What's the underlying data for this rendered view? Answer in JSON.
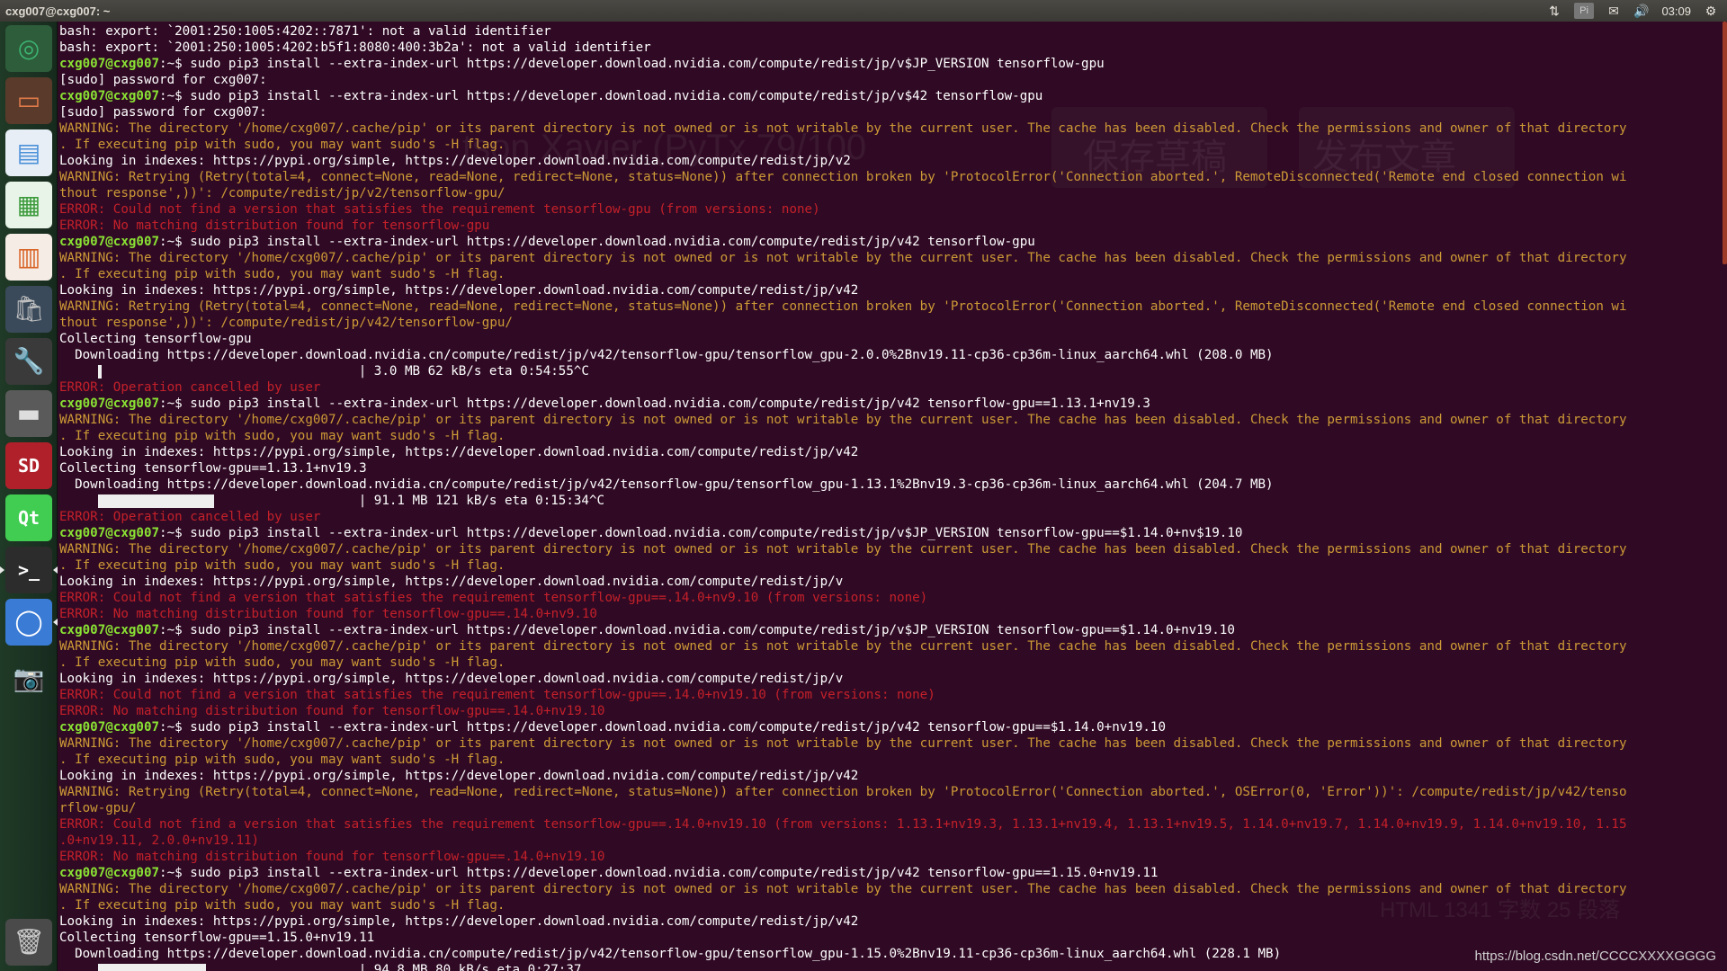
{
  "topbar": {
    "title": "cxg007@cxg007: ~",
    "indicators": {
      "network": "⇅",
      "keyboard": "Pi",
      "mail": "✉",
      "volume": "🔊",
      "clock": "03:09",
      "settings": "⚙"
    }
  },
  "launcher": {
    "items": [
      {
        "name": "chromium-icon",
        "glyph": "◎",
        "color": "#3cb371",
        "bg": "#2d5d3a"
      },
      {
        "name": "files-icon",
        "glyph": "▭",
        "color": "#e07a4a",
        "bg": "#5a3a2a"
      },
      {
        "name": "writer-icon",
        "glyph": "▤",
        "color": "#4a90d9",
        "bg": "#e8eef6"
      },
      {
        "name": "calc-icon",
        "glyph": "▦",
        "color": "#3a9a3a",
        "bg": "#e8f4e8"
      },
      {
        "name": "impress-icon",
        "glyph": "▥",
        "color": "#d9662a",
        "bg": "#f6ece6"
      },
      {
        "name": "software-center-icon",
        "glyph": "🛍",
        "color": "#c0c0c0",
        "bg": "#3a4a5a"
      },
      {
        "name": "system-settings-icon",
        "glyph": "🔧",
        "color": "#c0c0c0",
        "bg": "#3a3a3a"
      },
      {
        "name": "drive-icon",
        "glyph": "▬",
        "color": "#dddddd",
        "bg": "#5a5a5a"
      },
      {
        "name": "sd-card-icon",
        "glyph": "SD",
        "color": "#ffffff",
        "bg": "#b0202a"
      },
      {
        "name": "qt-creator-icon",
        "glyph": "Qt",
        "color": "#ffffff",
        "bg": "#41cd52"
      },
      {
        "name": "terminal-icon",
        "glyph": ">_",
        "color": "#ffffff",
        "bg": "#2c2c2c"
      },
      {
        "name": "browser-icon",
        "glyph": "◯",
        "color": "#ffffff",
        "bg": "#3a7bd5"
      },
      {
        "name": "camera-icon",
        "glyph": "📷",
        "color": "#aaaaaa",
        "bg": "transparent"
      },
      {
        "name": "trash-icon",
        "glyph": "🗑",
        "color": "#cccccc",
        "bg": "#4a4a4a"
      }
    ]
  },
  "terminal": {
    "prompt_user": "cxg007@cxg007",
    "prompt_sep": ":~$ ",
    "background_ghost": [
      "tson Xavier (PyTx 79/100",
      "保存草稿",
      "发布文章"
    ],
    "footer_ghost": "HTML  1341 字数  25 段落",
    "lines": [
      {
        "t": "bash: export: `2001:250:1005:4202::7871': not a valid identifier"
      },
      {
        "t": "bash: export: `2001:250:1005:4202:b5f1:8080:400:3b2a': not a valid identifier"
      },
      {
        "type": "cmd",
        "t": "sudo pip3 install --extra-index-url https://developer.download.nvidia.com/compute/redist/jp/v$JP_VERSION tensorflow-gpu"
      },
      {
        "t": "[sudo] password for cxg007:"
      },
      {
        "type": "cmd",
        "t": "sudo pip3 install --extra-index-url https://developer.download.nvidia.com/compute/redist/jp/v$42 tensorflow-gpu"
      },
      {
        "t": "[sudo] password for cxg007:"
      },
      {
        "c": "warn",
        "t": "WARNING: The directory '/home/cxg007/.cache/pip' or its parent directory is not owned or is not writable by the current user. The cache has been disabled. Check the permissions and owner of that directory"
      },
      {
        "c": "warn",
        "t": ". If executing pip with sudo, you may want sudo's -H flag."
      },
      {
        "t": "Looking in indexes: https://pypi.org/simple, https://developer.download.nvidia.com/compute/redist/jp/v2"
      },
      {
        "c": "warn",
        "t": "WARNING: Retrying (Retry(total=4, connect=None, read=None, redirect=None, status=None)) after connection broken by 'ProtocolError('Connection aborted.', RemoteDisconnected('Remote end closed connection wi"
      },
      {
        "c": "warn",
        "t": "thout response',))': /compute/redist/jp/v2/tensorflow-gpu/"
      },
      {
        "c": "err",
        "t": "ERROR: Could not find a version that satisfies the requirement tensorflow-gpu (from versions: none)"
      },
      {
        "c": "err",
        "t": "ERROR: No matching distribution found for tensorflow-gpu"
      },
      {
        "type": "cmd",
        "t": "sudo pip3 install --extra-index-url https://developer.download.nvidia.com/compute/redist/jp/v42 tensorflow-gpu"
      },
      {
        "c": "warn",
        "t": "WARNING: The directory '/home/cxg007/.cache/pip' or its parent directory is not owned or is not writable by the current user. The cache has been disabled. Check the permissions and owner of that directory"
      },
      {
        "c": "warn",
        "t": ". If executing pip with sudo, you may want sudo's -H flag."
      },
      {
        "t": "Looking in indexes: https://pypi.org/simple, https://developer.download.nvidia.com/compute/redist/jp/v42"
      },
      {
        "c": "warn",
        "t": "WARNING: Retrying (Retry(total=4, connect=None, read=None, redirect=None, status=None)) after connection broken by 'ProtocolError('Connection aborted.', RemoteDisconnected('Remote end closed connection wi"
      },
      {
        "c": "warn",
        "t": "thout response',))': /compute/redist/jp/v42/tensorflow-gpu/"
      },
      {
        "t": "Collecting tensorflow-gpu"
      },
      {
        "t": "  Downloading https://developer.download.nvidia.cn/compute/redist/jp/v42/tensorflow-gpu/tensorflow_gpu-2.0.0%2Bnv19.11-cp36-cp36m-linux_aarch64.whl (208.0 MB)"
      },
      {
        "type": "prog",
        "fill": 0.014,
        "t": "| 3.0 MB 62 kB/s eta 0:54:55^C"
      },
      {
        "c": "err",
        "t": "ERROR: Operation cancelled by user"
      },
      {
        "type": "cmd",
        "t": "sudo pip3 install --extra-index-url https://developer.download.nvidia.com/compute/redist/jp/v42 tensorflow-gpu==1.13.1+nv19.3"
      },
      {
        "c": "warn",
        "t": "WARNING: The directory '/home/cxg007/.cache/pip' or its parent directory is not owned or is not writable by the current user. The cache has been disabled. Check the permissions and owner of that directory"
      },
      {
        "c": "warn",
        "t": ". If executing pip with sudo, you may want sudo's -H flag."
      },
      {
        "t": "Looking in indexes: https://pypi.org/simple, https://developer.download.nvidia.com/compute/redist/jp/v42"
      },
      {
        "t": "Collecting tensorflow-gpu==1.13.1+nv19.3"
      },
      {
        "t": "  Downloading https://developer.download.nvidia.cn/compute/redist/jp/v42/tensorflow-gpu/tensorflow_gpu-1.13.1%2Bnv19.3-cp36-cp36m-linux_aarch64.whl (204.7 MB)"
      },
      {
        "type": "prog",
        "fill": 0.445,
        "t": "| 91.1 MB 121 kB/s eta 0:15:34^C"
      },
      {
        "c": "err",
        "t": "ERROR: Operation cancelled by user"
      },
      {
        "type": "cmd",
        "t": "sudo pip3 install --extra-index-url https://developer.download.nvidia.com/compute/redist/jp/v$JP_VERSION tensorflow-gpu==$1.14.0+nv$19.10"
      },
      {
        "c": "warn",
        "t": "WARNING: The directory '/home/cxg007/.cache/pip' or its parent directory is not owned or is not writable by the current user. The cache has been disabled. Check the permissions and owner of that directory"
      },
      {
        "c": "warn",
        "t": ". If executing pip with sudo, you may want sudo's -H flag."
      },
      {
        "t": "Looking in indexes: https://pypi.org/simple, https://developer.download.nvidia.com/compute/redist/jp/v"
      },
      {
        "c": "err",
        "t": "ERROR: Could not find a version that satisfies the requirement tensorflow-gpu==.14.0+nv9.10 (from versions: none)"
      },
      {
        "c": "err",
        "t": "ERROR: No matching distribution found for tensorflow-gpu==.14.0+nv9.10"
      },
      {
        "type": "cmd",
        "t": "sudo pip3 install --extra-index-url https://developer.download.nvidia.com/compute/redist/jp/v$JP_VERSION tensorflow-gpu==$1.14.0+nv19.10"
      },
      {
        "c": "warn",
        "t": "WARNING: The directory '/home/cxg007/.cache/pip' or its parent directory is not owned or is not writable by the current user. The cache has been disabled. Check the permissions and owner of that directory"
      },
      {
        "c": "warn",
        "t": ". If executing pip with sudo, you may want sudo's -H flag."
      },
      {
        "t": "Looking in indexes: https://pypi.org/simple, https://developer.download.nvidia.com/compute/redist/jp/v"
      },
      {
        "c": "err",
        "t": "ERROR: Could not find a version that satisfies the requirement tensorflow-gpu==.14.0+nv19.10 (from versions: none)"
      },
      {
        "c": "err",
        "t": "ERROR: No matching distribution found for tensorflow-gpu==.14.0+nv19.10"
      },
      {
        "type": "cmd",
        "t": "sudo pip3 install --extra-index-url https://developer.download.nvidia.com/compute/redist/jp/v42 tensorflow-gpu==$1.14.0+nv19.10"
      },
      {
        "c": "warn",
        "t": "WARNING: The directory '/home/cxg007/.cache/pip' or its parent directory is not owned or is not writable by the current user. The cache has been disabled. Check the permissions and owner of that directory"
      },
      {
        "c": "warn",
        "t": ". If executing pip with sudo, you may want sudo's -H flag."
      },
      {
        "t": "Looking in indexes: https://pypi.org/simple, https://developer.download.nvidia.com/compute/redist/jp/v42"
      },
      {
        "c": "warn",
        "t": "WARNING: Retrying (Retry(total=4, connect=None, read=None, redirect=None, status=None)) after connection broken by 'ProtocolError('Connection aborted.', OSError(0, 'Error'))': /compute/redist/jp/v42/tenso"
      },
      {
        "c": "warn",
        "t": "rflow-gpu/"
      },
      {
        "c": "err",
        "t": "ERROR: Could not find a version that satisfies the requirement tensorflow-gpu==.14.0+nv19.10 (from versions: 1.13.1+nv19.3, 1.13.1+nv19.4, 1.13.1+nv19.5, 1.14.0+nv19.7, 1.14.0+nv19.9, 1.14.0+nv19.10, 1.15"
      },
      {
        "c": "err",
        "t": ".0+nv19.11, 2.0.0+nv19.11)"
      },
      {
        "c": "err",
        "t": "ERROR: No matching distribution found for tensorflow-gpu==.14.0+nv19.10"
      },
      {
        "type": "cmd",
        "t": "sudo pip3 install --extra-index-url https://developer.download.nvidia.com/compute/redist/jp/v42 tensorflow-gpu==1.15.0+nv19.11"
      },
      {
        "c": "warn",
        "t": "WARNING: The directory '/home/cxg007/.cache/pip' or its parent directory is not owned or is not writable by the current user. The cache has been disabled. Check the permissions and owner of that directory"
      },
      {
        "c": "warn",
        "t": ". If executing pip with sudo, you may want sudo's -H flag."
      },
      {
        "t": "Looking in indexes: https://pypi.org/simple, https://developer.download.nvidia.com/compute/redist/jp/v42"
      },
      {
        "t": "Collecting tensorflow-gpu==1.15.0+nv19.11"
      },
      {
        "t": "  Downloading https://developer.download.nvidia.cn/compute/redist/jp/v42/tensorflow-gpu/tensorflow_gpu-1.15.0%2Bnv19.11-cp36-cp36m-linux_aarch64.whl (228.1 MB)"
      },
      {
        "type": "prog",
        "fill": 0.415,
        "t": "| 94.8 MB 80 kB/s eta 0:27:37"
      }
    ]
  },
  "watermark": "https://blog.csdn.net/CCCCXXXXGGGG"
}
